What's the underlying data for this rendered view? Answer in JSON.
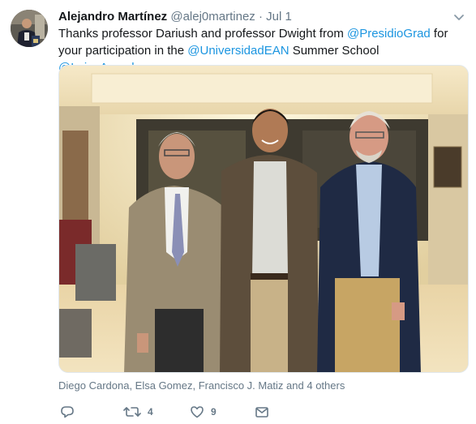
{
  "tweet": {
    "author_name": "Alejandro Martínez",
    "author_handle": "@alej0martinez",
    "separator": "·",
    "date": "Jul 1",
    "text_parts": {
      "t1": "Thanks professor Dariush and professor Dwight from ",
      "m1": "@PresidioGrad",
      "t2": " for your participation in the ",
      "m2": "@UniversidadEAN",
      "t3": "  Summer School ",
      "m3": "@Luis_Arevalo"
    },
    "tagged_people": "Diego Cardona, Elsa Gomez, Francisco J. Matiz and 4 others",
    "actions": {
      "reply_count": "",
      "retweet_count": "4",
      "like_count": "9"
    },
    "colors": {
      "mention": "#1b95e0",
      "secondary_text": "#657786",
      "primary_text": "#14171a"
    },
    "icons": [
      "reply-icon",
      "retweet-icon",
      "like-icon",
      "message-icon",
      "chevron-down-icon"
    ]
  }
}
